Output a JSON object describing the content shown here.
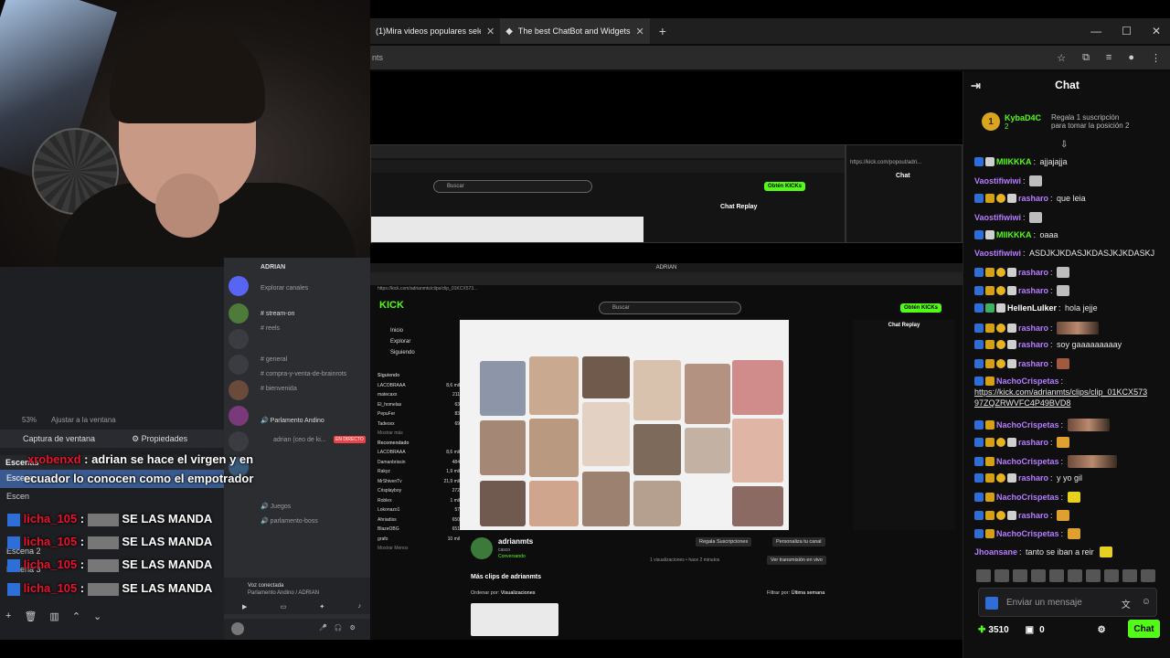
{
  "browser": {
    "tabs": [
      {
        "title": "(1)Mira videos populares selec"
      },
      {
        "title": "The best ChatBot and Widgets"
      }
    ],
    "address_fragment": "nts"
  },
  "nested": {
    "search_placeholder": "Buscar",
    "obtain_label": "Obtén KICKs",
    "url": "https://kick.com/popout/adri...",
    "url2": "https://kick.com/adrianmts/clips/clip_01KCX573...",
    "chat_label": "Chat",
    "chat_replay": "Chat Replay",
    "window_title": "ADRIAN",
    "streamer": "adrianmts",
    "streamer_sub": "casco",
    "streamer_status": "Conversando",
    "views": "1 visualizaciones • hace 2 minutos",
    "btn_subs": "Regala Suscripciones",
    "btn_channel": "Personaliza tu canal",
    "btn_live": "Ver transmisión en vivo",
    "more_clips": "Más clips de adrianmts",
    "sort_label": "Ordenar por:",
    "sort_value": "Visualizaciones",
    "filter_label": "Filtrar por:",
    "filter_value": "Última semana",
    "nav": [
      "Inicio",
      "Explorar",
      "Siguiendo"
    ],
    "following_heading": "Siguiendo",
    "recommended_heading": "Recomendado",
    "following": [
      {
        "name": "LACOBRAAA",
        "count": "8,6 mil"
      },
      {
        "name": "matecaxx",
        "count": "211"
      },
      {
        "name": "El_homelas",
        "count": "63"
      },
      {
        "name": "PepuFer",
        "count": "83"
      },
      {
        "name": "Tadeoxx",
        "count": "69"
      }
    ],
    "recommended": [
      {
        "name": "LACOBRAAA",
        "count": "8,6 mil"
      },
      {
        "name": "Damanbrissin",
        "count": "484"
      },
      {
        "name": "Rakyz",
        "count": "1,9 mil"
      },
      {
        "name": "MrShivenTv",
        "count": "21,9 mil"
      },
      {
        "name": "Crisplayboy",
        "count": "272"
      },
      {
        "name": "Roblex",
        "count": "1 mil"
      },
      {
        "name": "Lokonazo1",
        "count": "57"
      },
      {
        "name": "Ahriadiss",
        "count": "650"
      },
      {
        "name": "BlazeOBG",
        "count": "651"
      },
      {
        "name": "grafo",
        "count": "10 mil"
      }
    ],
    "show_more": "Mostrar más",
    "show_less": "Mostrar Menos"
  },
  "chat": {
    "title": "Chat",
    "gift_user": "KybaD4C",
    "gift_count": "2",
    "gift_text_1": "Regala 1 suscripción",
    "gift_text_2": "para tomar la posición 2",
    "messages": [
      {
        "user": "MIIKKKA",
        "text": "ajjajajja",
        "color": "#53fc18"
      },
      {
        "user": "Vaostifiwiwi",
        "text": "",
        "color": "#b57cff"
      },
      {
        "user": "rasharo",
        "text": "que leia",
        "color": "#b57cff"
      },
      {
        "user": "Vaostifiwiwi",
        "text": "",
        "color": "#b57cff"
      },
      {
        "user": "MIIKKKA",
        "text": "oaaa",
        "color": "#53fc18"
      },
      {
        "user": "Vaostifiwiwi",
        "text": "ASDJKJKDASJKDASJKJKDASKJ",
        "color": "#b57cff"
      },
      {
        "user": "rasharo",
        "text": "",
        "color": "#b57cff"
      },
      {
        "user": "rasharo",
        "text": "",
        "color": "#b57cff"
      },
      {
        "user": "HellenLulker",
        "text": "hola jejje",
        "color": "#ffffff"
      },
      {
        "user": "rasharo",
        "text": "",
        "color": "#b57cff"
      },
      {
        "user": "rasharo",
        "text": "soy gaaaaaaaaay",
        "color": "#b57cff"
      },
      {
        "user": "rasharo",
        "text": "",
        "color": "#b57cff"
      },
      {
        "user": "NachoCrispetas",
        "text": "",
        "color": "#b57cff"
      },
      {
        "user": "NachoCrispetas",
        "text": "",
        "color": "#b57cff"
      },
      {
        "user": "rasharo",
        "text": "",
        "color": "#b57cff"
      },
      {
        "user": "NachoCrispetas",
        "text": "",
        "color": "#b57cff"
      },
      {
        "user": "rasharo",
        "text": "y yo gil",
        "color": "#b57cff"
      },
      {
        "user": "NachoCrispetas",
        "text": "",
        "color": "#b57cff"
      },
      {
        "user": "rasharo",
        "text": "",
        "color": "#b57cff"
      },
      {
        "user": "NachoCrispetas",
        "text": "",
        "color": "#b57cff"
      },
      {
        "user": "Jhoansane",
        "text": "tanto se iban a reir",
        "color": "#b57cff"
      }
    ],
    "link_line_1": "https://kick.com/adrianmts/clips/clip_01KCX573",
    "link_line_2": "97ZQZRWVFC4P49BVD8",
    "input_placeholder": "Enviar un mensaje",
    "points": "3510",
    "points_2": "0",
    "chat_button": "Chat"
  },
  "obs": {
    "zoom": "53%",
    "fit_label": "Ajustar a la ventana",
    "source_name": "Captura de ventana",
    "properties": "Propiedades",
    "scenes_heading": "Escenas",
    "scenes": [
      "Escena",
      "Escena 2",
      "Escena 3"
    ]
  },
  "overlay": {
    "lines": [
      {
        "user": "xrobenxd",
        "text": "adrian se hace el virgen y en"
      },
      {
        "user": "",
        "text": "ecuador lo conocen como el empotrador"
      },
      {
        "user": "licha_105",
        "text": "SE LAS MANDA"
      },
      {
        "user": "licha_105",
        "text": "SE LAS MANDA"
      },
      {
        "user": "licha_105",
        "text": "SE LAS MANDA"
      },
      {
        "user": "licha_105",
        "text": "SE LAS MANDA"
      }
    ]
  },
  "discord": {
    "server": "ADRIAN",
    "channels": [
      "Explorar canales",
      "stream-on",
      "reels",
      "general",
      "compra-y-venta-de-brainrots",
      "bienvenida"
    ],
    "voice_channel": "Parlamento Andino",
    "voice_user": "adrian (ceo de ki...",
    "live_badge": "EN DIRECTO",
    "voice_status": "Voz conectada",
    "voice_path": "Parlamento Andino / ADRIAN",
    "other_channels": [
      "Juegos",
      "parlamento-boss"
    ]
  }
}
